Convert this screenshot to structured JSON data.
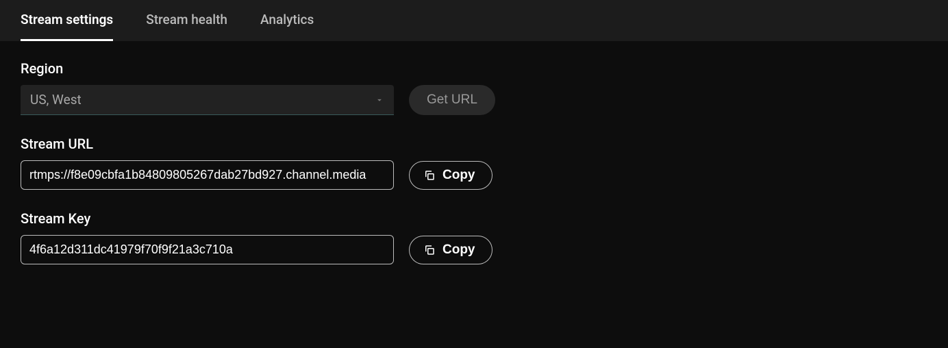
{
  "tabs": {
    "settings": "Stream settings",
    "health": "Stream health",
    "analytics": "Analytics"
  },
  "region": {
    "label": "Region",
    "selected": "US, West",
    "getUrlLabel": "Get URL"
  },
  "streamUrl": {
    "label": "Stream URL",
    "value": "rtmps://f8e09cbfa1b84809805267dab27bd927.channel.media",
    "copyLabel": "Copy"
  },
  "streamKey": {
    "label": "Stream Key",
    "value": "4f6a12d311dc41979f70f9f21a3c710a",
    "copyLabel": "Copy"
  }
}
